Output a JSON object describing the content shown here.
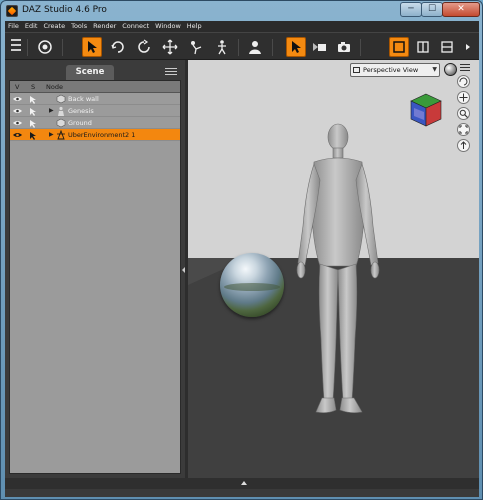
{
  "window": {
    "title": "DAZ Studio 4.6 Pro",
    "buttons": {
      "minimize": "─",
      "maximize": "☐",
      "close": "✕"
    }
  },
  "menu": [
    "File",
    "Edit",
    "Create",
    "Tools",
    "Render",
    "Connect",
    "Window",
    "Help"
  ],
  "toolbar": {
    "tools": [
      "grip-icon",
      "universal-tool-icon",
      "node-selection-icon",
      "rotate-icon",
      "rotate-cw-icon",
      "translate-icon",
      "joint-editor-icon",
      "figure-pose-icon",
      "surface-selection-icon",
      "region-navigator-icon",
      "spot-render-icon",
      "render-icon",
      "layout-single-icon",
      "layout-split-vertical-icon",
      "layout-split-horizontal-icon"
    ]
  },
  "scene": {
    "tab_label": "Scene",
    "columns": {
      "visible": "V",
      "selectable": "S",
      "node": "Node"
    },
    "rows": [
      {
        "label": "Back wall",
        "expandable": false,
        "selected": false
      },
      {
        "label": "Genesis",
        "expandable": true,
        "selected": false
      },
      {
        "label": "Ground",
        "expandable": false,
        "selected": false
      },
      {
        "label": "UberEnvironment2 1",
        "expandable": true,
        "selected": true
      }
    ]
  },
  "viewport": {
    "camera_label": "Perspective View",
    "dropdown_arrow": "▼"
  },
  "colors": {
    "accent": "#f48a11",
    "panel": "#3b3b3b",
    "scene_bg": "#9b9b9b"
  }
}
